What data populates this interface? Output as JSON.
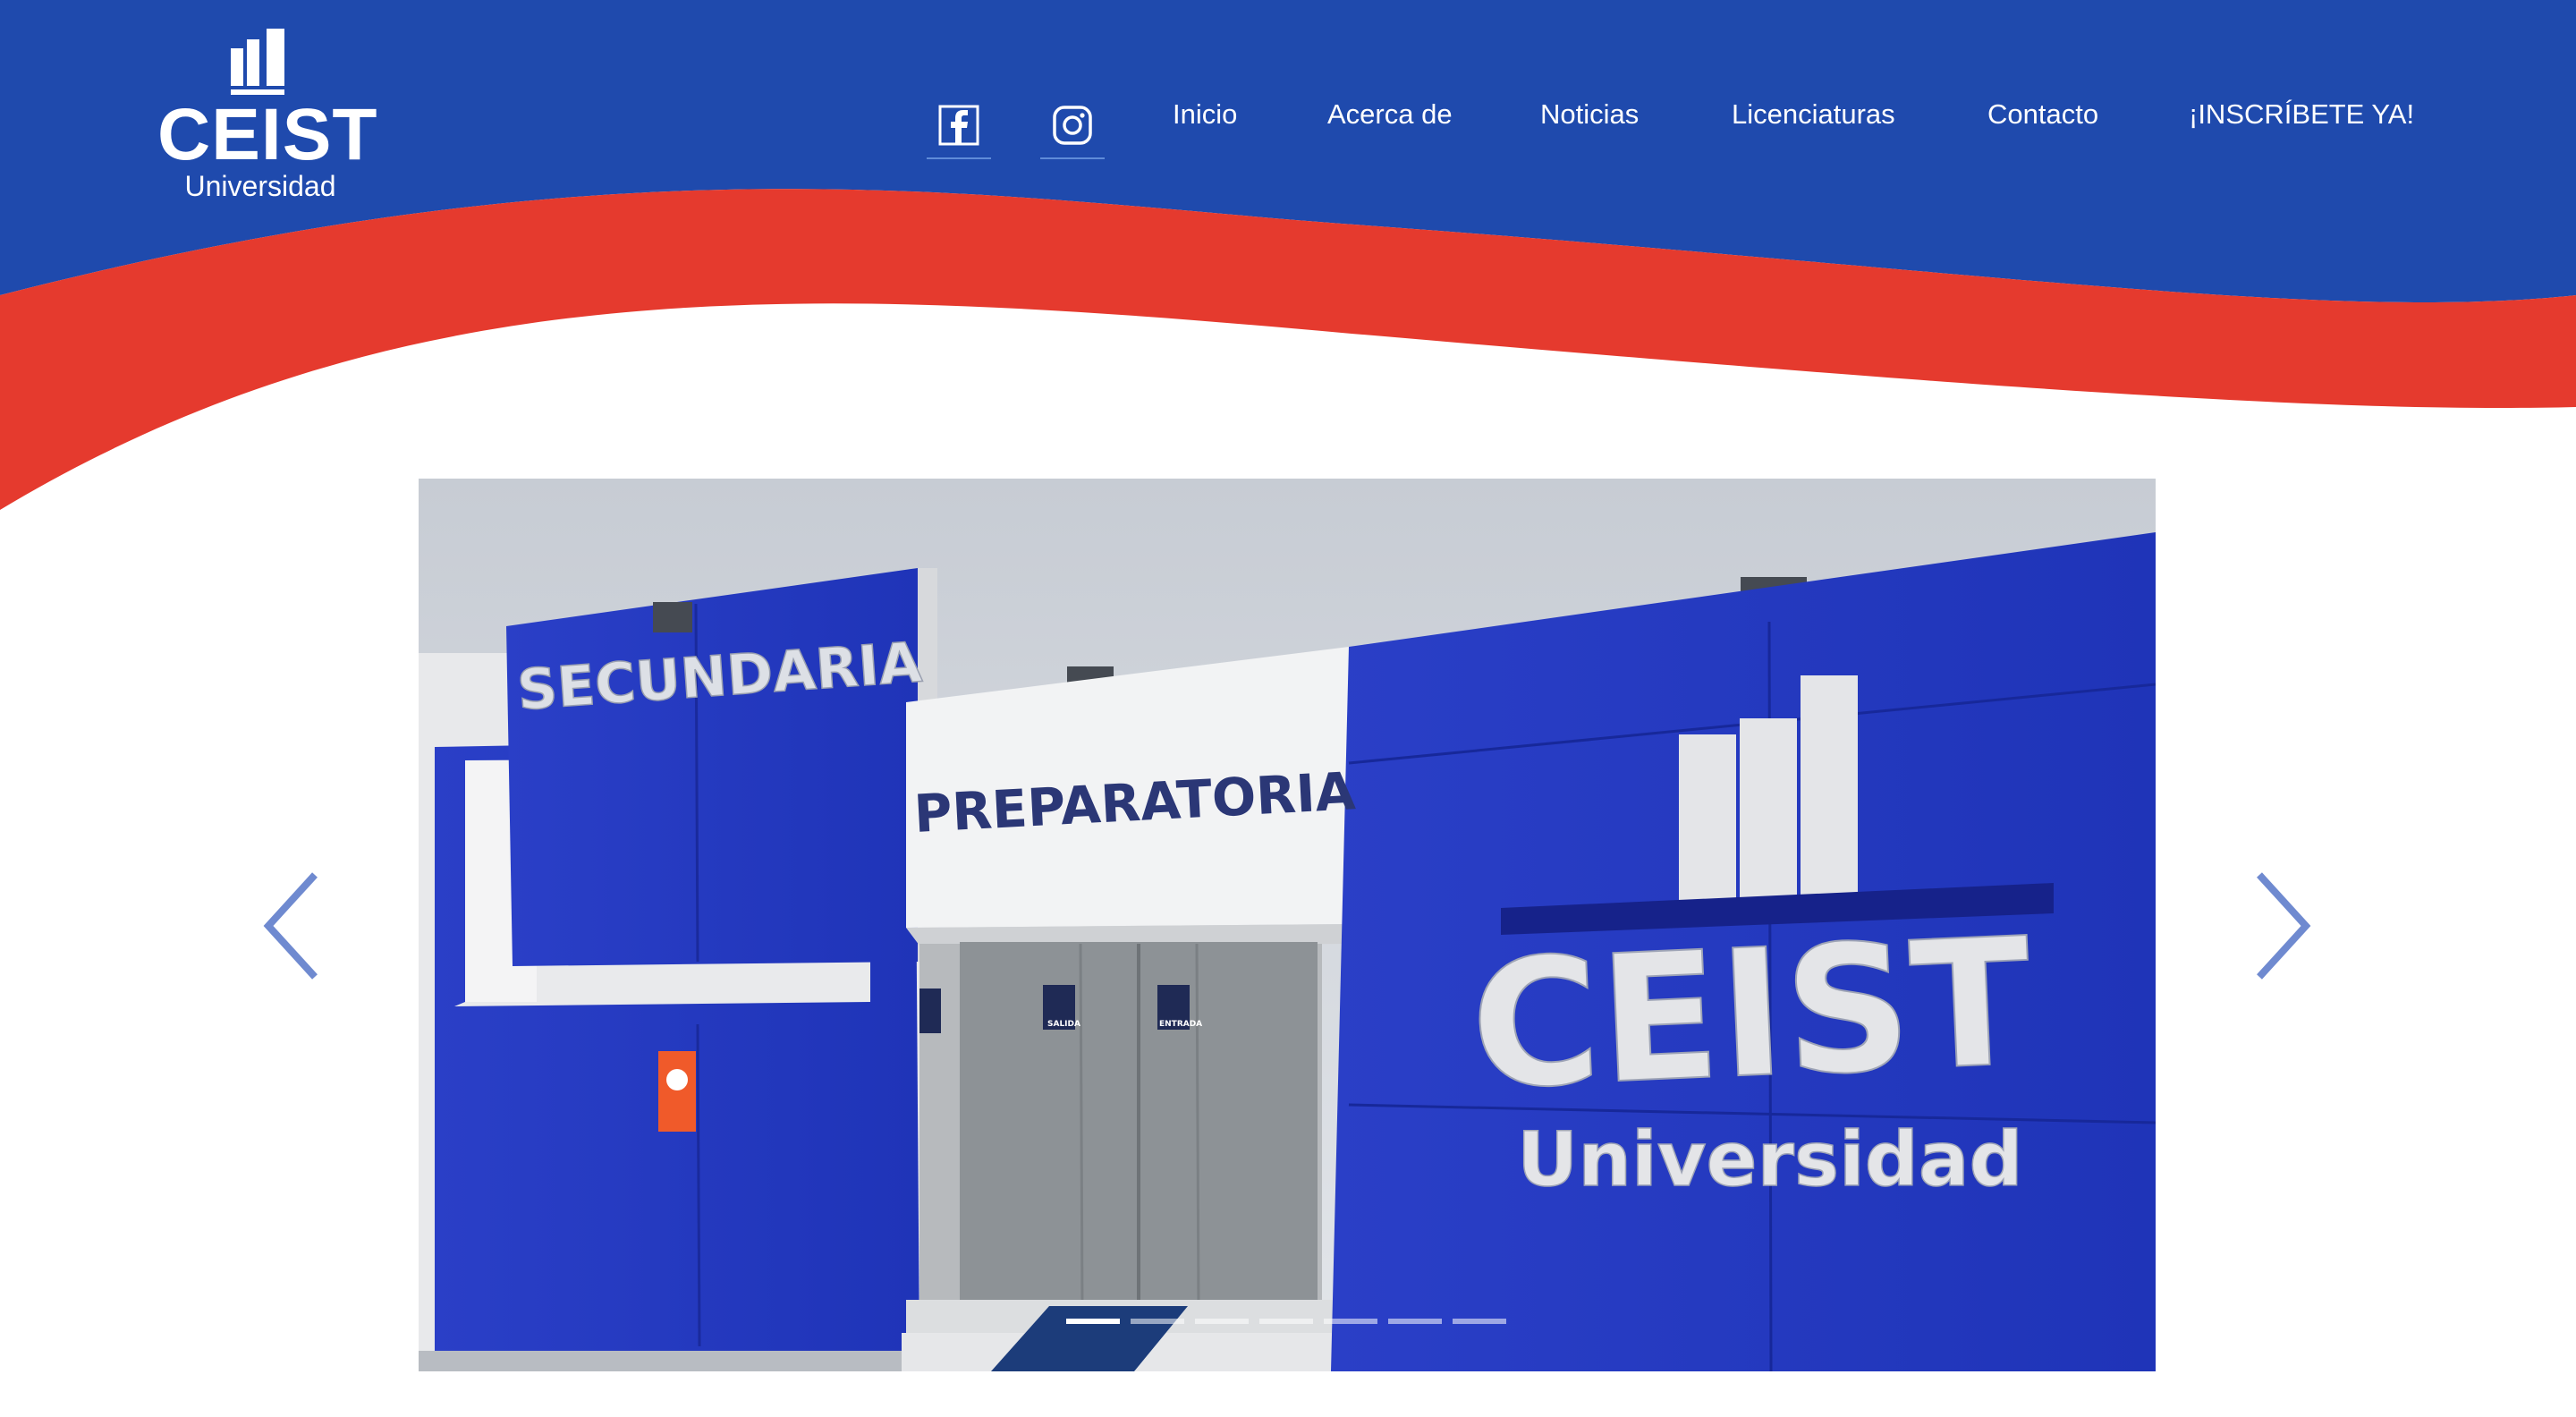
{
  "brand": {
    "name": "CEIST",
    "subtitle": "Universidad",
    "colors": {
      "primary_blue": "#1f4aad",
      "accent_red": "#e53a2e",
      "white": "#ffffff"
    }
  },
  "header": {
    "social": [
      {
        "name": "facebook-icon"
      },
      {
        "name": "instagram-icon"
      }
    ],
    "nav": [
      {
        "label": "Inicio"
      },
      {
        "label": "Acerca de"
      },
      {
        "label": "Noticias"
      },
      {
        "label": "Licenciaturas"
      },
      {
        "label": "Contacto"
      },
      {
        "label": "¡INSCRÍBETE YA!"
      }
    ]
  },
  "slider": {
    "slide_count": 7,
    "active_index": 0,
    "current_slide": {
      "signs": [
        "SECUNDARIA",
        "PREPARATORIA",
        "CEIST",
        "Universidad"
      ],
      "door_signs": [
        "SALIDA",
        "ENTRADA"
      ]
    }
  }
}
